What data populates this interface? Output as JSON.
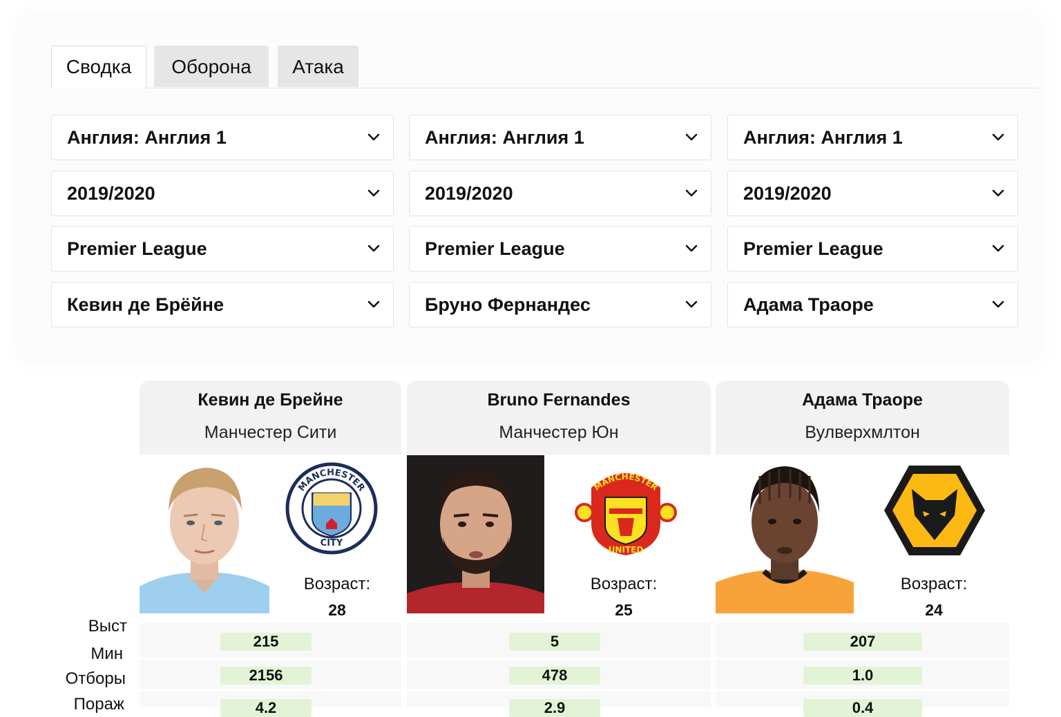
{
  "tabs": [
    {
      "label": "Сводка",
      "active": true
    },
    {
      "label": "Оборона",
      "active": false
    },
    {
      "label": "Атака",
      "active": false
    }
  ],
  "columns": [
    {
      "selects": {
        "country": "Англия: Англия 1",
        "season": "2019/2020",
        "league": "Premier League",
        "player": "Кевин де Брёйне"
      },
      "card": {
        "name": "Кевин де Брейне",
        "club": "Манчестер Сити",
        "age_label": "Возраст:",
        "age": "28",
        "crest_text_top": "MANCHESTER",
        "crest_text_bottom": "CITY"
      },
      "stats": [
        "215",
        "2156",
        "4.2"
      ]
    },
    {
      "selects": {
        "country": "Англия: Англия 1",
        "season": "2019/2020",
        "league": "Premier League",
        "player": "Бруно Фернандес"
      },
      "card": {
        "name": "Bruno Fernandes",
        "club": "Манчестер Юн",
        "age_label": "Возраст:",
        "age": "25",
        "crest_text_top": "MANCHESTER",
        "crest_text_bottom": "UNITED"
      },
      "stats": [
        "5",
        "478",
        "2.9"
      ]
    },
    {
      "selects": {
        "country": "Англия: Англия 1",
        "season": "2019/2020",
        "league": "Premier League",
        "player": "Адама Траоре"
      },
      "card": {
        "name": "Адама Траоре",
        "club": "Вулверхмлтон",
        "age_label": "Возраст:",
        "age": "24"
      },
      "stats": [
        "207",
        "1.0",
        "0.4"
      ]
    }
  ],
  "stat_labels": [
    "Выст",
    "Мин",
    "Отборы",
    "Пораж"
  ],
  "icons": {
    "dropdown": "chevron-down-icon",
    "col0_crest": "manchester-city-crest-icon",
    "col1_crest": "manchester-united-crest-icon",
    "col2_crest": "wolves-crest-icon"
  },
  "colors": {
    "stat_highlight": "#e3f4d6",
    "inactive_tab": "#e6e6e6",
    "card_header": "#f2f2f2"
  }
}
